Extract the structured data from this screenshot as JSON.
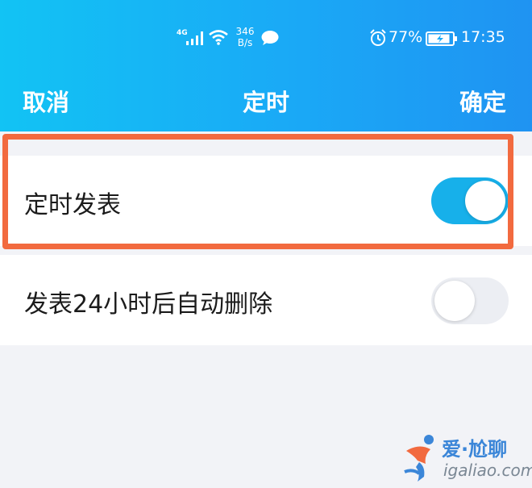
{
  "status_bar": {
    "network": "4G",
    "speed_value": "346",
    "speed_unit": "B/s",
    "battery_percent": "77%",
    "time": "17:35"
  },
  "nav": {
    "cancel_label": "取消",
    "title": "定时",
    "confirm_label": "确定"
  },
  "settings": [
    {
      "label": "定时发表",
      "enabled": true
    },
    {
      "label": "发表24小时后自动删除",
      "enabled": false
    }
  ],
  "watermark": {
    "title": "爱·尬聊",
    "url": "igaliao.com"
  },
  "colors": {
    "header_start": "#12c3f4",
    "header_end": "#1f93f2",
    "toggle_on": "#17b0ea",
    "highlight": "#f26a3f"
  }
}
